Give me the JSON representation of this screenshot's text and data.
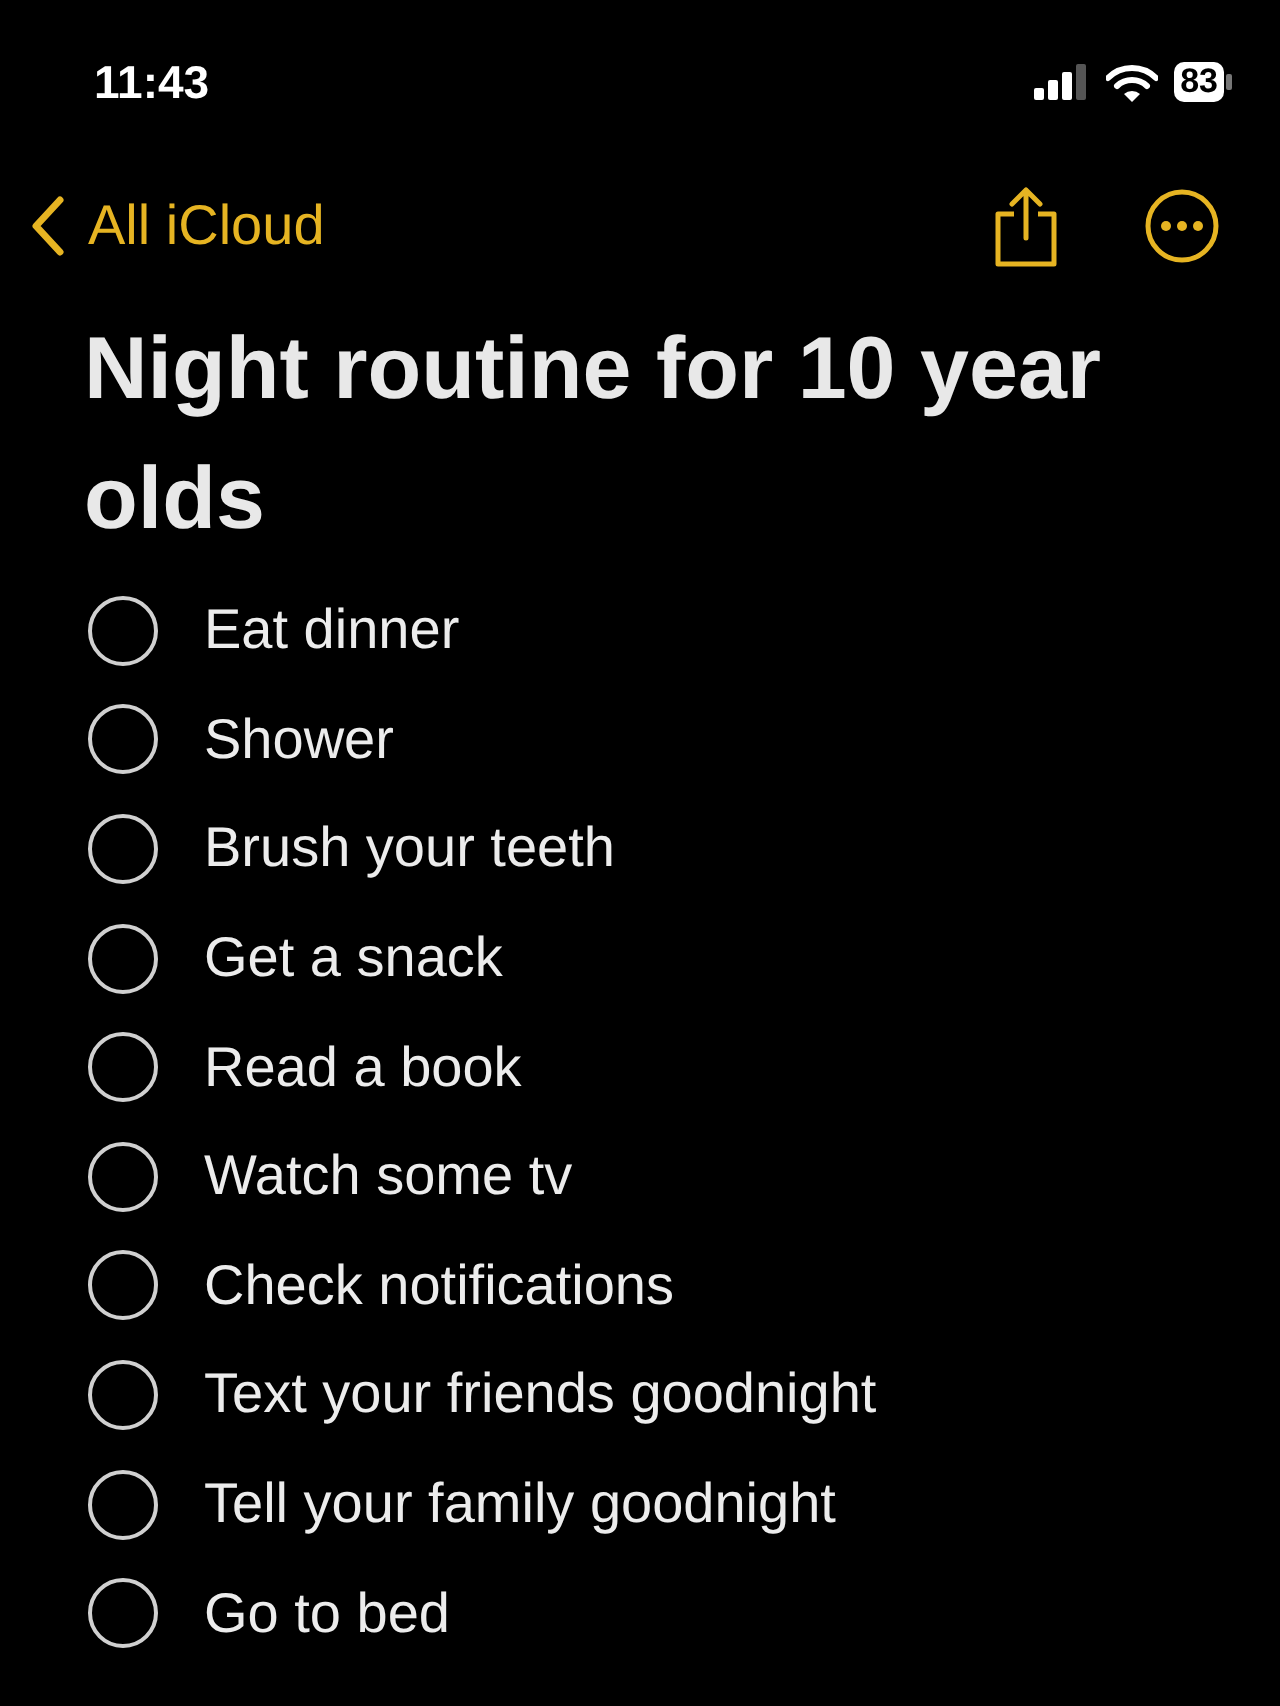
{
  "status_bar": {
    "time": "11:43",
    "battery": "83"
  },
  "nav": {
    "back_label": "All iCloud"
  },
  "note": {
    "title": "Night routine for 10 year olds",
    "items": [
      {
        "text": "Eat dinner",
        "checked": false
      },
      {
        "text": "Shower",
        "checked": false
      },
      {
        "text": "Brush your teeth",
        "checked": false
      },
      {
        "text": "Get a snack",
        "checked": false
      },
      {
        "text": "Read a book",
        "checked": false
      },
      {
        "text": "Watch some tv",
        "checked": false
      },
      {
        "text": "Check notifications",
        "checked": false
      },
      {
        "text": "Text your friends goodnight",
        "checked": false
      },
      {
        "text": "Tell your family goodnight",
        "checked": false
      },
      {
        "text": "Go to bed",
        "checked": false
      }
    ]
  }
}
